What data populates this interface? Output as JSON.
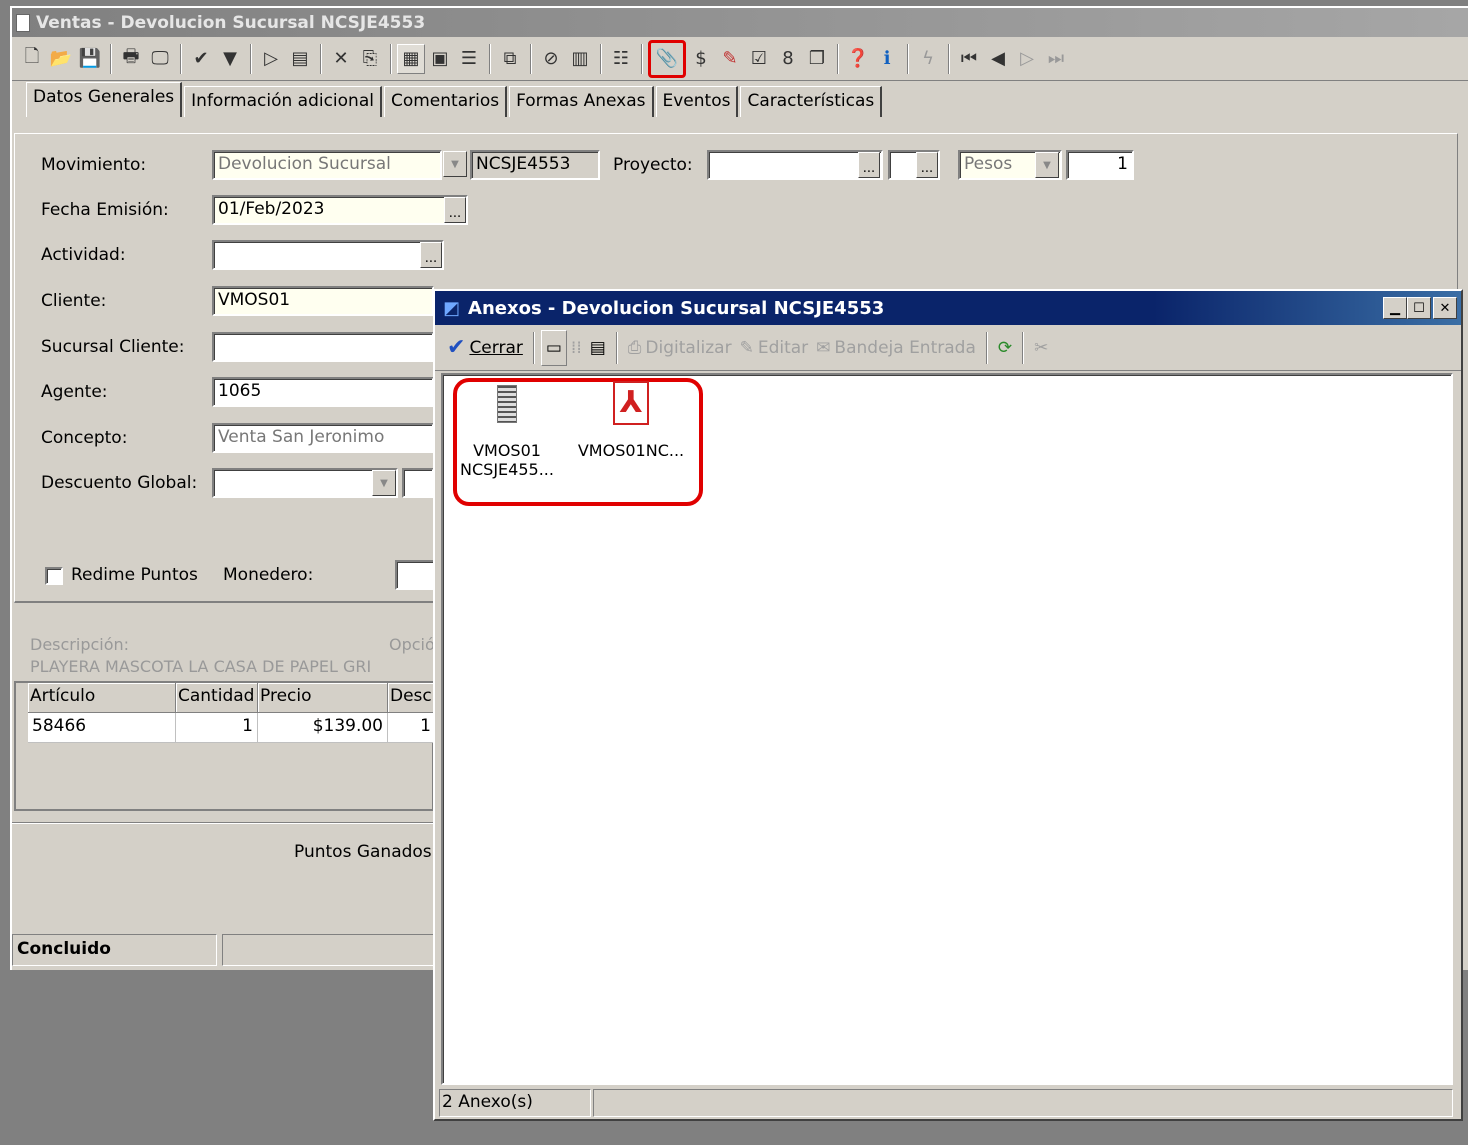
{
  "main": {
    "title": "Ventas - Devolucion Sucursal NCSJE4553",
    "tabs": [
      "Datos Generales",
      "Información adicional",
      "Comentarios",
      "Formas Anexas",
      "Eventos",
      "Características"
    ],
    "labels": {
      "movimiento": "Movimiento:",
      "proyecto": "Proyecto:",
      "fecha": "Fecha Emisión:",
      "actividad": "Actividad:",
      "cliente": "Cliente:",
      "sucursal": "Sucursal Cliente:",
      "agente": "Agente:",
      "concepto": "Concepto:",
      "descuento": "Descuento Global:",
      "redime": "Redime Puntos",
      "monedero": "Monedero:"
    },
    "values": {
      "movimiento": "Devolucion Sucursal",
      "folio": "NCSJE4553",
      "moneda": "Pesos",
      "tipo_cambio": "1",
      "fecha": "01/Feb/2023",
      "cliente": "VMOS01",
      "agente": "1065",
      "concepto": "Venta San Jeronimo"
    },
    "descripcion_label": "Descripción:",
    "descripcion_value": "PLAYERA MASCOTA LA CASA DE PAPEL GRI",
    "opciones_label": "Opció",
    "grid": {
      "headers": [
        "Artículo",
        "Cantidad",
        "Precio",
        "Desc"
      ],
      "row": [
        "58466",
        "1",
        "$139.00",
        "1"
      ]
    },
    "puntos_ganados": "Puntos Ganados:",
    "status": "Concluido"
  },
  "dialog": {
    "title": "Anexos - Devolucion Sucursal NCSJE4553",
    "cerrar": "Cerrar",
    "digitalizar": "Digitalizar",
    "editar": "Editar",
    "bandeja": "Bandeja Entrada",
    "files": [
      {
        "line1": "VMOS01",
        "line2": "NCSJE455..."
      },
      {
        "line1": "VMOS01NC...",
        "line2": ""
      }
    ],
    "status": "2 Anexo(s)"
  },
  "colors": {
    "highlight": "#e00000",
    "dialog_title": "#0a246a",
    "window_bg": "#d4d0c8"
  }
}
